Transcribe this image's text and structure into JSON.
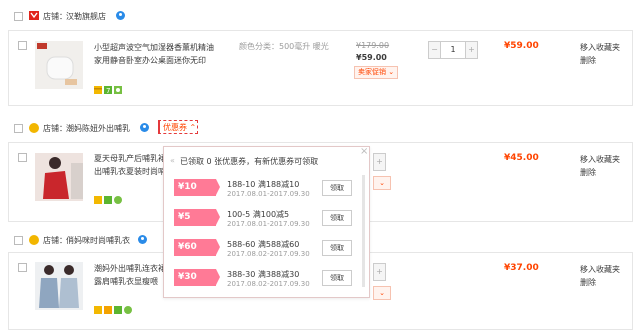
{
  "stores": [
    {
      "prefix": "店铺：",
      "name": "汉勒旗舰店"
    },
    {
      "prefix": "店铺：",
      "name": "潮妈陈妞外出哺乳"
    },
    {
      "prefix": "店铺：",
      "name": "俏妈咪时尚哺乳衣"
    }
  ],
  "coupon_trigger": "优惠券",
  "items": [
    {
      "title": "小型超声波空气加湿器香薰机精油家用静音卧室办公桌面迷你无印",
      "sku": "颜色分类：500毫升  暖光",
      "old_price": "¥179.00",
      "price": "¥59.00",
      "promo": "卖家促销",
      "qty": "1",
      "total": "¥59.00",
      "op1": "移入收藏夹",
      "op2": "删除"
    },
    {
      "title": "夏天母乳产后哺乳裙外出哺乳衣夏装时尚哺乳",
      "total": "¥45.00",
      "op1": "移入收藏夹",
      "op2": "删除"
    },
    {
      "title": "潮妈外出哺乳连衣裙露肩哺乳衣显瘦喂",
      "total": "¥37.00",
      "op1": "移入收藏夹",
      "op2": "删除"
    }
  ],
  "popup": {
    "header": "已领取 0 张优惠券，有新优惠券可领取",
    "claim_label": "领取",
    "coupons": [
      {
        "amount": "¥10",
        "desc": "188-10 满188减10",
        "date": "2017.08.01-2017.09.30"
      },
      {
        "amount": "¥5",
        "desc": "100-5 满100减5",
        "date": "2017.08.01-2017.09.30"
      },
      {
        "amount": "¥60",
        "desc": "588-60 满588减60",
        "date": "2017.08.02-2017.09.30"
      },
      {
        "amount": "¥30",
        "desc": "388-30 满388减30",
        "date": "2017.08.02-2017.09.30"
      }
    ]
  },
  "colors": {
    "accent": "#ff4400",
    "coupon": "#ff7a96"
  }
}
